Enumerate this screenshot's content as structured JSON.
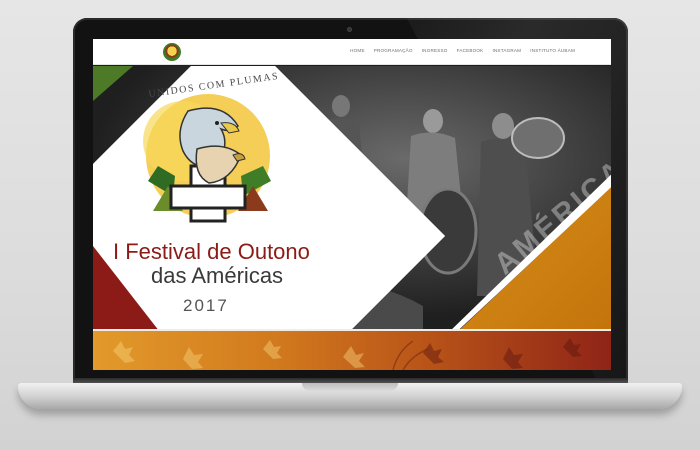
{
  "nav": {
    "items": [
      {
        "label": "HOME"
      },
      {
        "label": "PROGRAMAÇÃO"
      },
      {
        "label": "INGRESSO"
      },
      {
        "label": "FACEBOOK"
      },
      {
        "label": "INSTAGRAM"
      },
      {
        "label": "INSTITUTO ÁUBAM"
      }
    ]
  },
  "hero": {
    "tagline": "UNIDOS COM PLUMAS",
    "title": "I Festival de Outono",
    "subtitle": "das Américas",
    "year": "2017",
    "side_text": "AMÉRICA"
  },
  "colors": {
    "brand_red": "#8c1b17",
    "brand_orange": "#d9901a",
    "brand_green": "#4c7a26",
    "nav_text": "#6d6d6d"
  }
}
